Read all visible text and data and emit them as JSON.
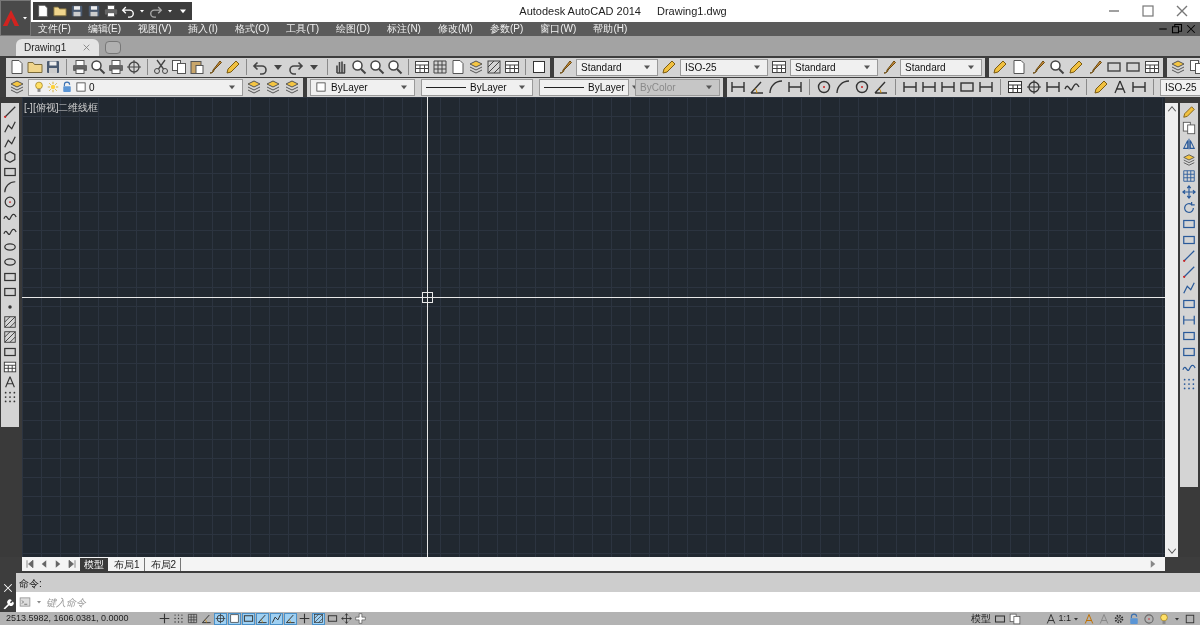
{
  "title_bar": {
    "app": "Autodesk AutoCAD 2014",
    "document": "Drawing1.dwg"
  },
  "menu": [
    "文件(F)",
    "编辑(E)",
    "视图(V)",
    "插入(I)",
    "格式(O)",
    "工具(T)",
    "绘图(D)",
    "标注(N)",
    "修改(M)",
    "参数(P)",
    "窗口(W)",
    "帮助(H)"
  ],
  "document_tabs": [
    {
      "label": "Drawing1",
      "selected": true
    }
  ],
  "styles_toolbar": {
    "text_style": "Standard",
    "dimension_style": "ISO-25",
    "table_style": "Standard",
    "multileader_style": "Standard"
  },
  "properties_toolbar": {
    "layer": "0",
    "color_control": "ByLayer",
    "linetype": "ByLayer",
    "lineweight": "ByLayer",
    "plot_style": {
      "value": "ByColor",
      "disabled": true
    }
  },
  "dimension_toolbar": {
    "dimension_style": "ISO-25"
  },
  "viewport": {
    "label": "[-][俯视]二维线框"
  },
  "layout_tabs": [
    {
      "label": "模型",
      "selected": true
    },
    {
      "label": "布局1",
      "selected": false
    },
    {
      "label": "布局2",
      "selected": false
    }
  ],
  "command_line": {
    "prompt": "命令:",
    "placeholder": "键入命令"
  },
  "status_bar": {
    "coordinates": "2513.5982, 1606.0381, 0.0000",
    "toggles": [
      {
        "on": false
      },
      {
        "on": false
      },
      {
        "on": false
      },
      {
        "on": false
      },
      {
        "on": true
      },
      {
        "on": true
      },
      {
        "on": true
      },
      {
        "on": true
      },
      {
        "on": true
      },
      {
        "on": true
      },
      {
        "on": false
      },
      {
        "on": true
      },
      {
        "on": false
      },
      {
        "on": false
      },
      {
        "on": false
      }
    ],
    "space": "模型",
    "annotation_scale": "1:1"
  }
}
